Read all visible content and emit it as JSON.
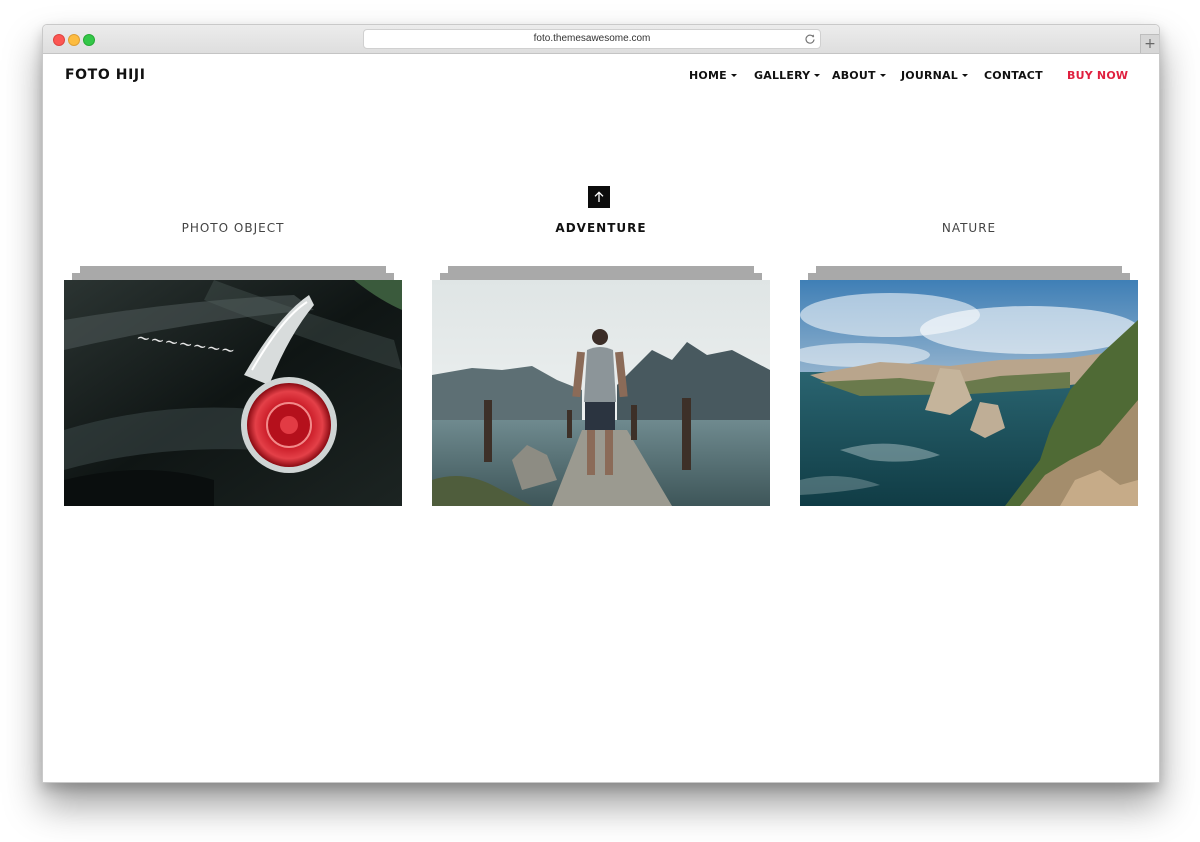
{
  "browser": {
    "url": "foto.themesawesome.com",
    "new_tab_symbol": "+"
  },
  "site": {
    "logo": "FOTO HIJI"
  },
  "nav": {
    "items": [
      {
        "label": "HOME",
        "has_dropdown": true
      },
      {
        "label": "GALLERY",
        "has_dropdown": true
      },
      {
        "label": "ABOUT",
        "has_dropdown": true
      },
      {
        "label": "JOURNAL",
        "has_dropdown": true
      },
      {
        "label": "CONTACT",
        "has_dropdown": false
      }
    ],
    "cta": {
      "label": "BUY NOW",
      "color": "#e0203f"
    }
  },
  "gallery": {
    "active_index": 1,
    "categories": [
      {
        "title": "PHOTO OBJECT",
        "image": "vintage car tail light"
      },
      {
        "title": "ADVENTURE",
        "image": "man standing on stone pier by mountain lake"
      },
      {
        "title": "NATURE",
        "image": "coastal cliffs and sea"
      }
    ]
  },
  "icons": {
    "scroll_up": "arrow-up-icon",
    "reload": "reload-icon"
  }
}
